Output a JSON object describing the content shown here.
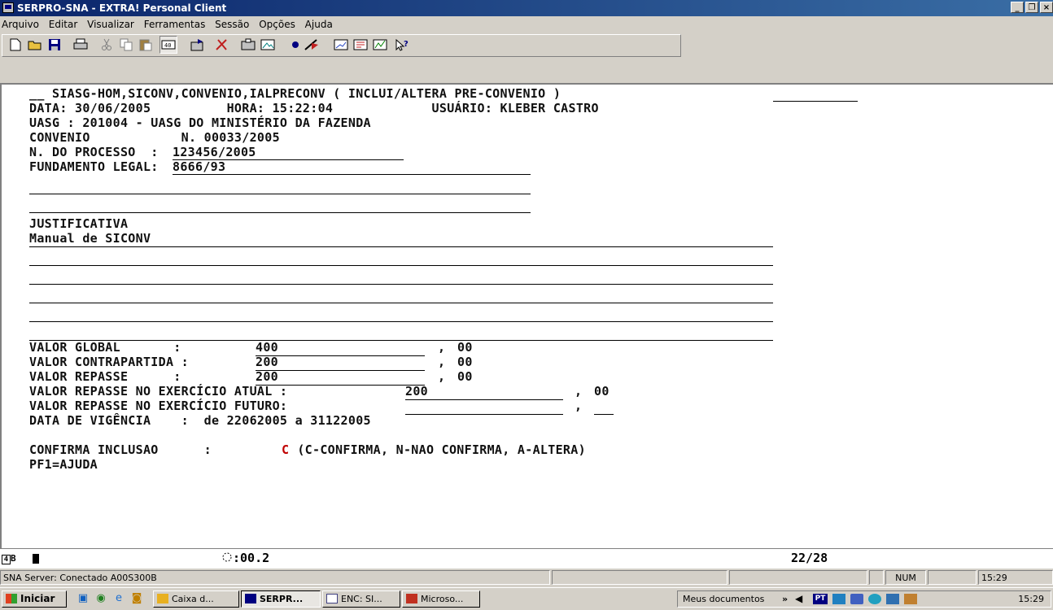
{
  "window": {
    "title": "SERPRO-SNA - EXTRA! Personal Client",
    "minimize_glyph": "_",
    "maximize_glyph": "❐",
    "close_glyph": "×"
  },
  "menu": [
    "Arquivo",
    "Editar",
    "Visualizar",
    "Ferramentas",
    "Sessão",
    "Opções",
    "Ajuda"
  ],
  "toolbar_icons": [
    "new-icon",
    "open-icon",
    "save-icon",
    "print-icon",
    "cut-icon",
    "copy-icon",
    "paste-icon",
    "quick-pad-icon",
    "send-file-icon",
    "tools-icon",
    "macro-icon",
    "session-icon",
    "record-icon",
    "play-icon",
    "edit-icon",
    "options-icon",
    "settings-icon",
    "help-icon"
  ],
  "screen": {
    "header": "__ SIASG-HOM,SICONV,CONVENIO,IALPRECONV ( INCLUI/ALTERA PRE-CONVENIO )",
    "date_line": "DATA: 30/06/2005          HORA: 15:22:04             USUÁRIO: KLEBER CASTRO",
    "uasg_line": "UASG : 201004 - UASG DO MINISTÉRIO DA FAZENDA",
    "convenio_line": "CONVENIO            N. 00033/2005",
    "processo_label": "N. DO PROCESSO  : ",
    "processo_value": "123456/2005",
    "fundamento_label": "FUNDAMENTO LEGAL: ",
    "fundamento_value": "8666/93",
    "justificativa_label": "JUSTIFICATIVA",
    "justificativa_value": "Manual de SICONV",
    "valor_global_label": "VALOR GLOBAL       : ",
    "valor_global_value": "400",
    "valor_contrapartida_label": "VALOR CONTRAPARTIDA : ",
    "valor_contrapartida_value": "200",
    "valor_repasse_label": "VALOR REPASSE      : ",
    "valor_repasse_value": "200",
    "repasse_atual_label": "VALOR REPASSE NO EXERCÍCIO ATUAL : ",
    "repasse_atual_value": "200",
    "repasse_futuro_label": "VALOR REPASSE NO EXERCÍCIO FUTURO:",
    "cents_sep": ",",
    "cents_value": "00",
    "vigencia_line": "DATA DE VIGÊNCIA    :  de 22062005 a 31122005",
    "confirma_label": "CONFIRMA INCLUSAO      : ",
    "confirma_value": "C",
    "confirma_hint": " (C-CONFIRMA, N-NAO CONFIRMA, A-ALTERA)",
    "pf1": "PF1=AJUDA"
  },
  "oia": {
    "mode": "B",
    "timer": ":00.2",
    "position": "22/28"
  },
  "statusbar": {
    "connection": "SNA Server: Conectado A00S300B",
    "num": "NUM",
    "time": "15:29"
  },
  "taskbar": {
    "start": "Iniciar",
    "tasks": [
      "Caixa d...",
      "SERPR...",
      "ENC: SI...",
      "Microso..."
    ],
    "tray_label": "Meus documentos",
    "tray_chevron": "»",
    "lang": "PT",
    "clock": "15:29"
  }
}
